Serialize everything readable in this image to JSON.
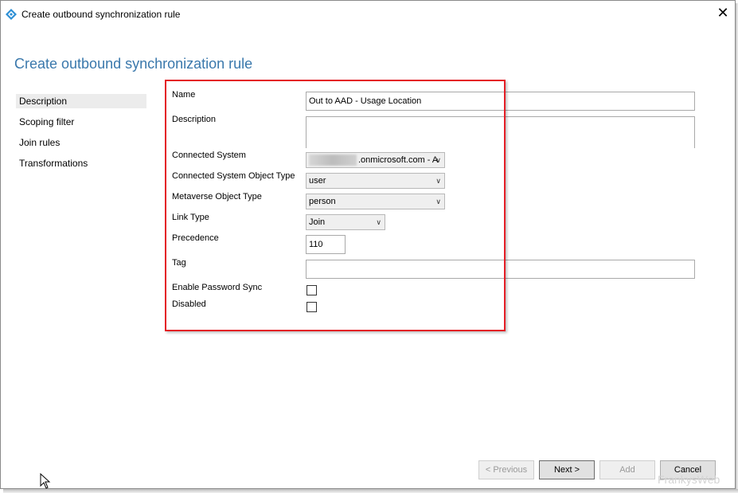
{
  "window": {
    "title": "Create outbound synchronization rule",
    "close_glyph": "✕"
  },
  "heading": "Create outbound synchronization rule",
  "nav": {
    "items": [
      {
        "label": "Description",
        "selected": true
      },
      {
        "label": "Scoping filter",
        "selected": false
      },
      {
        "label": "Join rules",
        "selected": false
      },
      {
        "label": "Transformations",
        "selected": false
      }
    ]
  },
  "form": {
    "name_label": "Name",
    "name_value": "Out to AAD - Usage Location",
    "description_label": "Description",
    "description_value": "",
    "connected_system_label": "Connected System",
    "connected_system_value": ".onmicrosoft.com - A",
    "cs_object_type_label": "Connected System Object Type",
    "cs_object_type_value": "user",
    "mv_object_type_label": "Metaverse Object Type",
    "mv_object_type_value": "person",
    "link_type_label": "Link Type",
    "link_type_value": "Join",
    "precedence_label": "Precedence",
    "precedence_value": "110",
    "tag_label": "Tag",
    "tag_value": "",
    "enable_password_sync_label": "Enable Password Sync",
    "enable_password_sync_checked": false,
    "disabled_label": "Disabled",
    "disabled_checked": false
  },
  "buttons": {
    "previous": "< Previous",
    "next": "Next >",
    "add": "Add",
    "cancel": "Cancel"
  },
  "watermark": "FrankysWeb",
  "icons": {
    "app": "azure-ad-connect-icon",
    "dropdown": "chevron-down-icon",
    "cursor": "mouse-pointer-icon"
  },
  "colors": {
    "heading": "#3a78ac",
    "highlight_box": "#e41e26",
    "app_icon": "#2d8fd5"
  }
}
